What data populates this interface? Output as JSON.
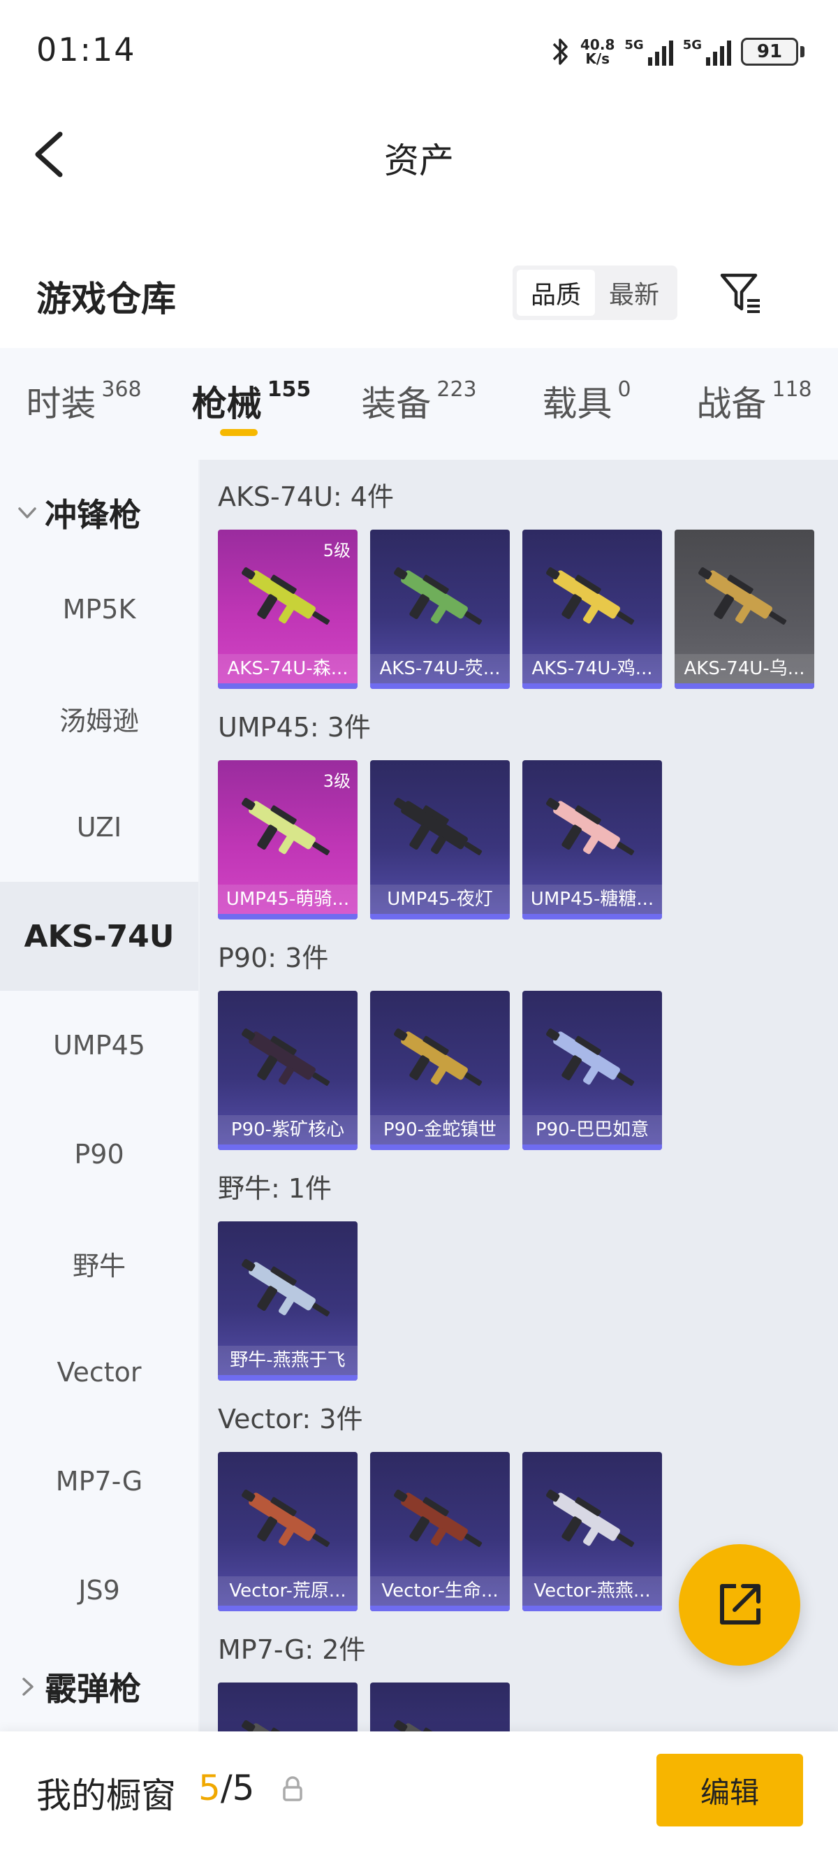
{
  "status_bar": {
    "time": "01:14",
    "net_speed": "40.8",
    "net_unit": "K/s",
    "sig1_label": "5G",
    "sig2_label": "5G",
    "battery": "91"
  },
  "header": {
    "title": "资产"
  },
  "warehouse": {
    "title": "游戏仓库",
    "sort_options": [
      "品质",
      "最新"
    ],
    "active_sort": "品质"
  },
  "tabs": [
    {
      "label": "时装",
      "count": "368"
    },
    {
      "label": "枪械",
      "count": "155"
    },
    {
      "label": "装备",
      "count": "223"
    },
    {
      "label": "载具",
      "count": "0"
    },
    {
      "label": "战备",
      "count": "118"
    }
  ],
  "active_tab": "枪械",
  "sidebar": {
    "category_expanded": "冲锋枪",
    "items": [
      "MP5K",
      "汤姆逊",
      "UZI",
      "AKS-74U",
      "UMP45",
      "P90",
      "野牛",
      "Vector",
      "MP7-G",
      "JS9"
    ],
    "active_item": "AKS-74U",
    "category_collapsed": "霰弹枪"
  },
  "groups": [
    {
      "title": "AKS-74U: 4件",
      "items": [
        {
          "name": "AKS-74U-森...",
          "level": "5级",
          "bg": "pink",
          "gun_color": "#c8d238"
        },
        {
          "name": "AKS-74U-荧...",
          "level": "",
          "bg": "purple",
          "gun_color": "#6fae5a"
        },
        {
          "name": "AKS-74U-鸡...",
          "level": "",
          "bg": "purple",
          "gun_color": "#e8c84a"
        },
        {
          "name": "AKS-74U-乌...",
          "level": "",
          "bg": "grey",
          "gun_color": "#c9a04a"
        }
      ]
    },
    {
      "title": "UMP45: 3件",
      "items": [
        {
          "name": "UMP45-萌骑...",
          "level": "3级",
          "bg": "pink",
          "gun_color": "#d8e68a"
        },
        {
          "name": "UMP45-夜灯",
          "level": "",
          "bg": "purple",
          "gun_color": "#2a2a2e"
        },
        {
          "name": "UMP45-糖糖...",
          "level": "",
          "bg": "purple",
          "gun_color": "#f0b8b8"
        }
      ]
    },
    {
      "title": "P90: 3件",
      "items": [
        {
          "name": "P90-紫矿核心",
          "level": "",
          "bg": "purple",
          "gun_color": "#3a2a3e"
        },
        {
          "name": "P90-金蛇镇世",
          "level": "",
          "bg": "purple",
          "gun_color": "#c8a040"
        },
        {
          "name": "P90-巴巴如意",
          "level": "",
          "bg": "purple",
          "gun_color": "#a8b8e8"
        }
      ]
    },
    {
      "title": "野牛: 1件",
      "items": [
        {
          "name": "野牛-燕燕于飞",
          "level": "",
          "bg": "purple",
          "gun_color": "#b8c8e0"
        }
      ]
    },
    {
      "title": "Vector: 3件",
      "items": [
        {
          "name": "Vector-荒原...",
          "level": "",
          "bg": "purple",
          "gun_color": "#b8583a"
        },
        {
          "name": "Vector-生命...",
          "level": "",
          "bg": "purple",
          "gun_color": "#8a3a2a"
        },
        {
          "name": "Vector-燕燕...",
          "level": "",
          "bg": "purple",
          "gun_color": "#d8d8e4"
        }
      ]
    },
    {
      "title": "MP7-G: 2件",
      "items": [
        {
          "name": "",
          "level": "",
          "bg": "purple",
          "gun_color": "#555"
        },
        {
          "name": "",
          "level": "",
          "bg": "purple",
          "gun_color": "#555"
        }
      ]
    }
  ],
  "bottom_bar": {
    "label": "我的橱窗",
    "current": "5",
    "separator": "/",
    "total": "5",
    "edit_label": "编辑"
  },
  "colors": {
    "accent": "#f7b500",
    "card_purple": "#3a357c",
    "card_pink": "#c036b6",
    "card_grey": "#5a5a60",
    "sidebar_bg": "#f6f8fc"
  }
}
